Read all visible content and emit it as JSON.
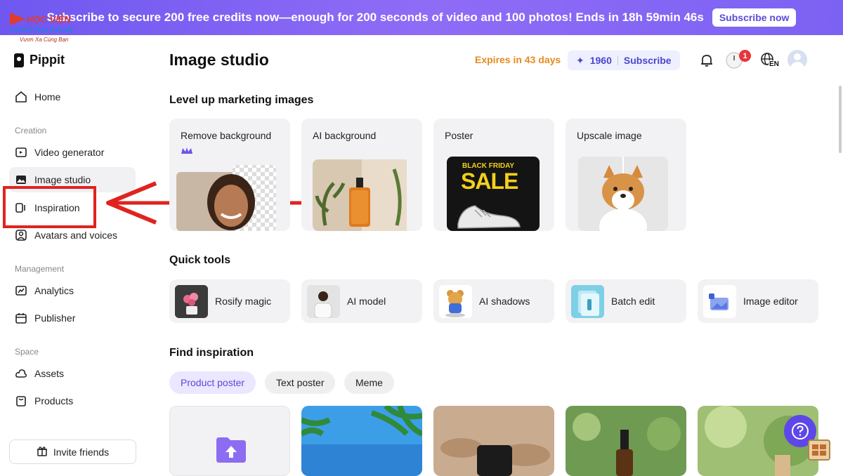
{
  "banner": {
    "text": "Subscribe to secure 200 free credits now—enough for 200 seconds of video and 100 photos! Ends in 18h 59min 46s",
    "button": "Subscribe now"
  },
  "watermark": {
    "line1": "HỌC VIỆN",
    "line2": "MARKETING ONLINE",
    "line3": "Vươn Xa Cùng Bạn"
  },
  "app": {
    "name": "Pippit"
  },
  "sidebar": {
    "home": "Home",
    "section_creation": "Creation",
    "video_generator": "Video generator",
    "image_studio": "Image studio",
    "inspiration": "Inspiration",
    "avatars_voices": "Avatars and voices",
    "section_management": "Management",
    "analytics": "Analytics",
    "publisher": "Publisher",
    "section_space": "Space",
    "assets": "Assets",
    "products": "Products",
    "invite": "Invite friends"
  },
  "header": {
    "title": "Image studio",
    "expires": "Expires in 43 days",
    "credits": "1960",
    "subscribe": "Subscribe",
    "notification_count": "1",
    "language": "EN"
  },
  "level_up": {
    "title": "Level up marketing images",
    "cards": [
      {
        "label": "Remove background"
      },
      {
        "label": "AI background"
      },
      {
        "label": "Poster",
        "poster_line1": "BLACK FRIDAY",
        "poster_line2": "SALE"
      },
      {
        "label": "Upscale image"
      }
    ]
  },
  "quick_tools": {
    "title": "Quick tools",
    "items": [
      {
        "label": "Rosify magic"
      },
      {
        "label": "AI model"
      },
      {
        "label": "AI shadows"
      },
      {
        "label": "Batch edit"
      },
      {
        "label": "Image editor"
      }
    ]
  },
  "inspiration": {
    "title": "Find inspiration",
    "chips": [
      "Product poster",
      "Text poster",
      "Meme"
    ],
    "active_chip": "Product poster"
  },
  "colors": {
    "accent": "#5e47e8",
    "highlight": "#e0231e",
    "expires": "#e58a1f"
  }
}
